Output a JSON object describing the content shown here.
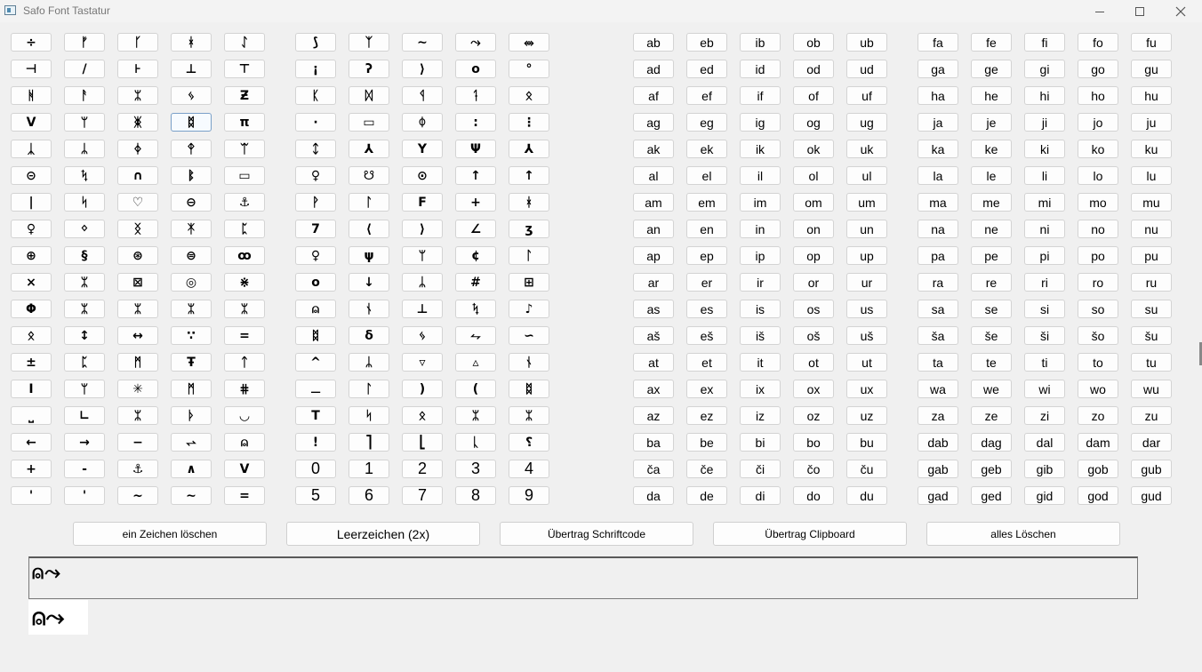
{
  "window": {
    "title": "Safo Font Tastatur",
    "minimize_icon": "minimize-icon",
    "maximize_icon": "maximize-icon",
    "close_icon": "close-icon"
  },
  "symbol_keys": [
    [
      "÷",
      "ᚠ",
      "ᚴ",
      "ᚼ",
      "ᛇ",
      "⟆",
      "ᛉ",
      "∼",
      "⤳",
      "⥈"
    ],
    [
      "⊣",
      "/",
      "⊦",
      "⊥",
      "⊤",
      "¡",
      "ʔ",
      "⟩",
      "o",
      "°"
    ],
    [
      "ᚻ",
      "ᚨ",
      "ᛯ",
      "ᛃ",
      "Ƶ",
      "ᛕ",
      "ᛞ",
      "ᛩ",
      "ᛑ",
      "ᛟ"
    ],
    [
      "V",
      "ᛘ",
      "ᛤ",
      "ᛥ",
      "π",
      "·",
      "▭",
      "ᛰ",
      ":",
      "⋮"
    ],
    [
      "ᛣ",
      "ᛦ",
      "ᛄ",
      "ᛳ",
      "ᛠ",
      "ᛨ",
      "⅄",
      "Y",
      "Ψ",
      "⅄"
    ],
    [
      "⊝",
      "ᛪ",
      "∩",
      "ᛔ",
      "▭",
      "♀",
      "☋",
      "⊙",
      "↑",
      "↑"
    ],
    [
      "|",
      "ᛋ",
      "♡",
      "⊖",
      "⚓",
      "ᚹ",
      "ᛚ",
      "F",
      "+",
      "ᚼ"
    ],
    [
      "♀",
      "ᛜ",
      "ᛝ",
      "ᛡ",
      "ᛈ",
      "7",
      "⟨",
      "⟩",
      "∠",
      "ʒ"
    ],
    [
      "⊕",
      "§",
      "⊛",
      "⊜",
      "ꝏ",
      "♀",
      "ψ",
      "ᛘ",
      "¢",
      "ᛚ"
    ],
    [
      "×",
      "ᛯ",
      "⊠",
      "◎",
      "⋇",
      "o",
      "↓",
      "ᛦ",
      "#",
      "⊞"
    ],
    [
      "Φ",
      "ᛯ",
      "ᛯ",
      "ᛯ",
      "ᛯ",
      "⍝",
      "ᚾ",
      "⊥",
      "ᛪ",
      "♪"
    ],
    [
      "ᛟ",
      "↕",
      "↔",
      "∵",
      "=",
      "ᛥ",
      "δ",
      "ᛃ",
      "⥊",
      "∽"
    ],
    [
      "±",
      "ᛈ",
      "ᛗ",
      "Ŧ",
      "ᛏ",
      "^",
      "ᛦ",
      "▿",
      "▵",
      "ᚾ"
    ],
    [
      "Ⅰ",
      "ᛘ",
      "✳",
      "ᛗ",
      "⋕",
      "⚊",
      "ᛚ",
      ")",
      "(",
      "ᛥ"
    ],
    [
      "⎵",
      "∟",
      "ᛯ",
      "ᚦ",
      "◡",
      "T",
      "ᛋ",
      "ᛟ",
      "ᛯ",
      "ᛯ"
    ],
    [
      "←",
      "→",
      "−",
      "⥋",
      "⍝",
      "!",
      "⎤",
      "⎣",
      "ᚳ",
      "⸮"
    ],
    [
      "+",
      "-",
      "⚓",
      "∧",
      "Ⅴ",
      "0",
      "1",
      "2",
      "3",
      "4"
    ],
    [
      "'",
      "'",
      "~",
      "∼",
      "=",
      "5",
      "6",
      "7",
      "8",
      "9"
    ]
  ],
  "syllable_keys": [
    [
      "ab",
      "eb",
      "ib",
      "ob",
      "ub",
      "fa",
      "fe",
      "fi",
      "fo",
      "fu"
    ],
    [
      "ad",
      "ed",
      "id",
      "od",
      "ud",
      "ga",
      "ge",
      "gi",
      "go",
      "gu"
    ],
    [
      "af",
      "ef",
      "if",
      "of",
      "uf",
      "ha",
      "he",
      "hi",
      "ho",
      "hu"
    ],
    [
      "ag",
      "eg",
      "ig",
      "og",
      "ug",
      "ja",
      "je",
      "ji",
      "jo",
      "ju"
    ],
    [
      "ak",
      "ek",
      "ik",
      "ok",
      "uk",
      "ka",
      "ke",
      "ki",
      "ko",
      "ku"
    ],
    [
      "al",
      "el",
      "il",
      "ol",
      "ul",
      "la",
      "le",
      "li",
      "lo",
      "lu"
    ],
    [
      "am",
      "em",
      "im",
      "om",
      "um",
      "ma",
      "me",
      "mi",
      "mo",
      "mu"
    ],
    [
      "an",
      "en",
      "in",
      "on",
      "un",
      "na",
      "ne",
      "ni",
      "no",
      "nu"
    ],
    [
      "ap",
      "ep",
      "ip",
      "op",
      "up",
      "pa",
      "pe",
      "pi",
      "po",
      "pu"
    ],
    [
      "ar",
      "er",
      "ir",
      "or",
      "ur",
      "ra",
      "re",
      "ri",
      "ro",
      "ru"
    ],
    [
      "as",
      "es",
      "is",
      "os",
      "us",
      "sa",
      "se",
      "si",
      "so",
      "su"
    ],
    [
      "aš",
      "eš",
      "iš",
      "oš",
      "uš",
      "ša",
      "še",
      "ši",
      "šo",
      "šu"
    ],
    [
      "at",
      "et",
      "it",
      "ot",
      "ut",
      "ta",
      "te",
      "ti",
      "to",
      "tu"
    ],
    [
      "ax",
      "ex",
      "ix",
      "ox",
      "ux",
      "wa",
      "we",
      "wi",
      "wo",
      "wu"
    ],
    [
      "az",
      "ez",
      "iz",
      "oz",
      "uz",
      "za",
      "ze",
      "zi",
      "zo",
      "zu"
    ],
    [
      "ba",
      "be",
      "bi",
      "bo",
      "bu",
      "dab",
      "dag",
      "dal",
      "dam",
      "dar"
    ],
    [
      "ča",
      "če",
      "či",
      "čo",
      "ču",
      "gab",
      "geb",
      "gib",
      "gob",
      "gub"
    ],
    [
      "da",
      "de",
      "di",
      "do",
      "du",
      "gad",
      "ged",
      "gid",
      "god",
      "gud"
    ]
  ],
  "actions": {
    "delete_one": "ein Zeichen löschen",
    "space": "Leerzeichen (2x)",
    "transfer_fontcode": "Übertrag Schriftcode",
    "transfer_clipboard": "Übertrag Clipboard",
    "delete_all": "alles Löschen"
  },
  "output": {
    "text": "⍝⤳",
    "preview": "⍝⤳"
  }
}
